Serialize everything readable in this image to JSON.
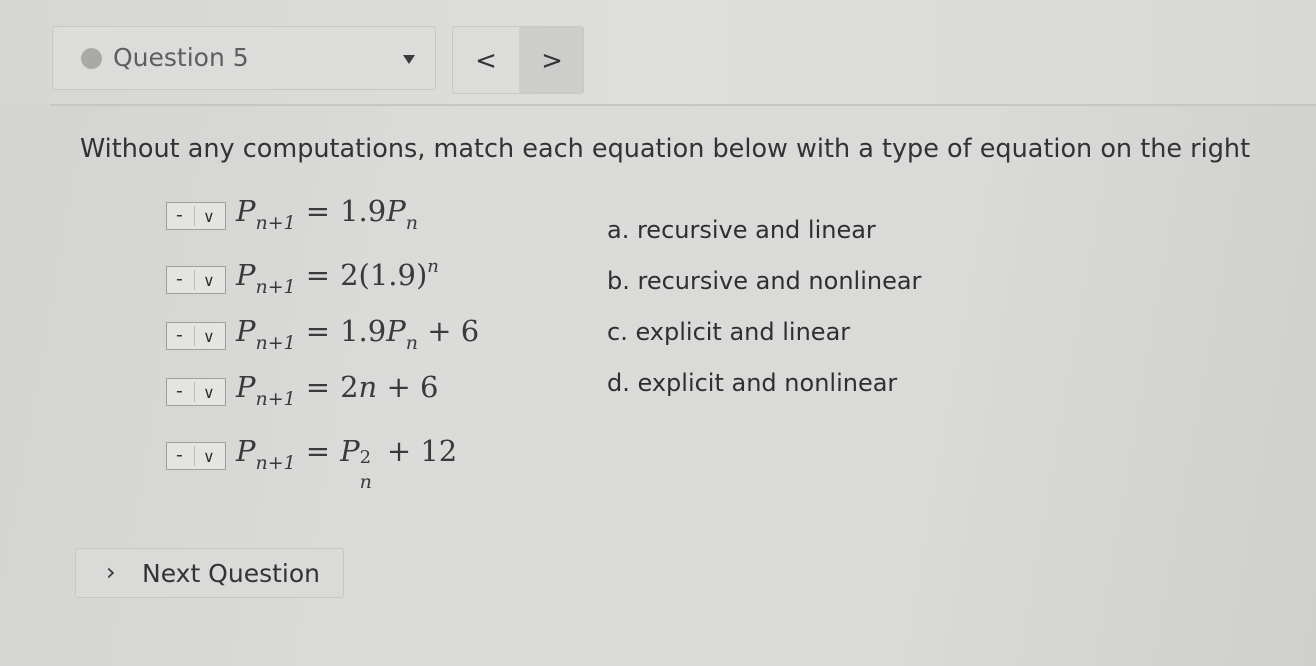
{
  "header": {
    "question_label": "Question 5",
    "prev_label": "<",
    "next_label": ">"
  },
  "instruction": "Without any computations, match each equation below with a type of equation on the right",
  "equations": [
    {
      "select_value": "-",
      "lhs_var": "P",
      "lhs_sub": "n+1",
      "rhs_text": "1.9",
      "rhs_var": "P",
      "rhs_sub": "n"
    },
    {
      "select_value": "-",
      "lhs_var": "P",
      "lhs_sub": "n+1",
      "rhs_text": "2(1.9)",
      "rhs_sup": "n"
    },
    {
      "select_value": "-",
      "lhs_var": "P",
      "lhs_sub": "n+1",
      "rhs_text": "1.9",
      "rhs_var": "P",
      "rhs_sub": "n",
      "rhs_tail": "+ 6"
    },
    {
      "select_value": "-",
      "lhs_var": "P",
      "lhs_sub": "n+1",
      "rhs_text": "2",
      "rhs_var": "n",
      "rhs_tail": "+ 6"
    },
    {
      "select_value": "-",
      "lhs_var": "P",
      "lhs_sub": "n+1",
      "rhs_var": "P",
      "rhs_sup": "2",
      "rhs_sub": "n",
      "rhs_tail": "+ 12"
    }
  ],
  "options": [
    "a. recursive and linear",
    "b. recursive and nonlinear",
    "c. explicit and linear",
    "d. explicit and nonlinear"
  ],
  "next_question_label": "Next Question",
  "icons": {
    "status_dot": "circle-icon",
    "dropdown": "caret-down-icon",
    "select": "chevron-down-icon",
    "next": "chevron-right-icon"
  }
}
